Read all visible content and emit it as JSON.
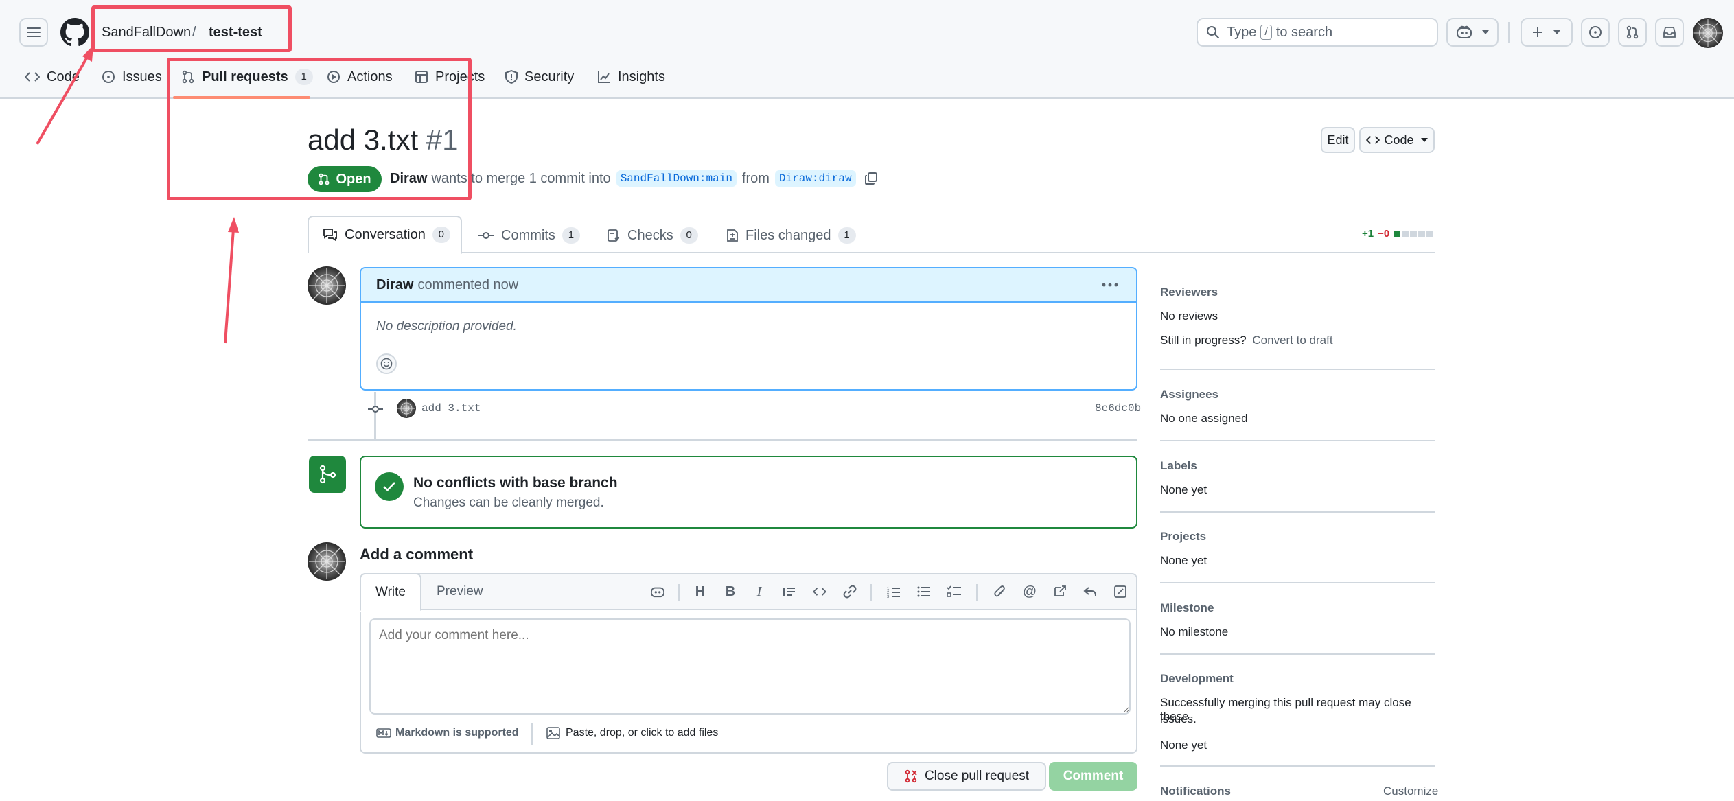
{
  "header": {
    "owner": "SandFallDown",
    "separator": "/",
    "repo": "test-test",
    "search_prefix": "Type",
    "search_key": "/",
    "search_suffix": "to search"
  },
  "repo_tabs": [
    {
      "label": "Code",
      "icon": "code-icon"
    },
    {
      "label": "Issues",
      "icon": "issue-icon"
    },
    {
      "label": "Pull requests",
      "icon": "pull-request-icon",
      "count": "1"
    },
    {
      "label": "Actions",
      "icon": "play-icon"
    },
    {
      "label": "Projects",
      "icon": "table-icon"
    },
    {
      "label": "Security",
      "icon": "shield-icon"
    },
    {
      "label": "Insights",
      "icon": "graph-icon"
    }
  ],
  "pr": {
    "title": "add 3.txt",
    "number": "#1",
    "state": "Open",
    "author": "Diraw",
    "merge_text": "wants to merge 1 commit into",
    "base": "SandFallDown:main",
    "from_text": "from",
    "head": "Diraw:diraw",
    "edit_label": "Edit",
    "code_label": "Code"
  },
  "pr_tabs": [
    {
      "label": "Conversation",
      "count": "0"
    },
    {
      "label": "Commits",
      "count": "1"
    },
    {
      "label": "Checks",
      "count": "0"
    },
    {
      "label": "Files changed",
      "count": "1"
    }
  ],
  "diffstat": {
    "added": "+1",
    "removed": "−0"
  },
  "comment": {
    "author": "Diraw",
    "action": "commented now",
    "body": "No description provided.",
    "commit_message": "add 3.txt",
    "commit_sha": "8e6dc0b"
  },
  "merge": {
    "title": "No conflicts with base branch",
    "subtitle": "Changes can be cleanly merged."
  },
  "add_comment": {
    "heading": "Add a comment",
    "tab_write": "Write",
    "tab_preview": "Preview",
    "placeholder": "Add your comment here...",
    "markdown_note": "Markdown is supported",
    "attach_note": "Paste, drop, or click to add files",
    "close_button": "Close pull request",
    "comment_button": "Comment"
  },
  "sidebar": {
    "reviewers_h": "Reviewers",
    "reviewers_v": "No reviews",
    "progress_q": "Still in progress?",
    "progress_link": "Convert to draft",
    "assignees_h": "Assignees",
    "assignees_v": "No one assigned",
    "labels_h": "Labels",
    "labels_v": "None yet",
    "projects_h": "Projects",
    "projects_v": "None yet",
    "milestone_h": "Milestone",
    "milestone_v": "No milestone",
    "development_h": "Development",
    "development_v1": "Successfully merging this pull request may close these",
    "development_v2": "issues.",
    "development_v3": "None yet",
    "notifications_h": "Notifications",
    "customize": "Customize"
  },
  "colors": {
    "accent_green": "#1f883d",
    "link_blue": "#0969da",
    "annotation_red": "#ef4f62"
  }
}
